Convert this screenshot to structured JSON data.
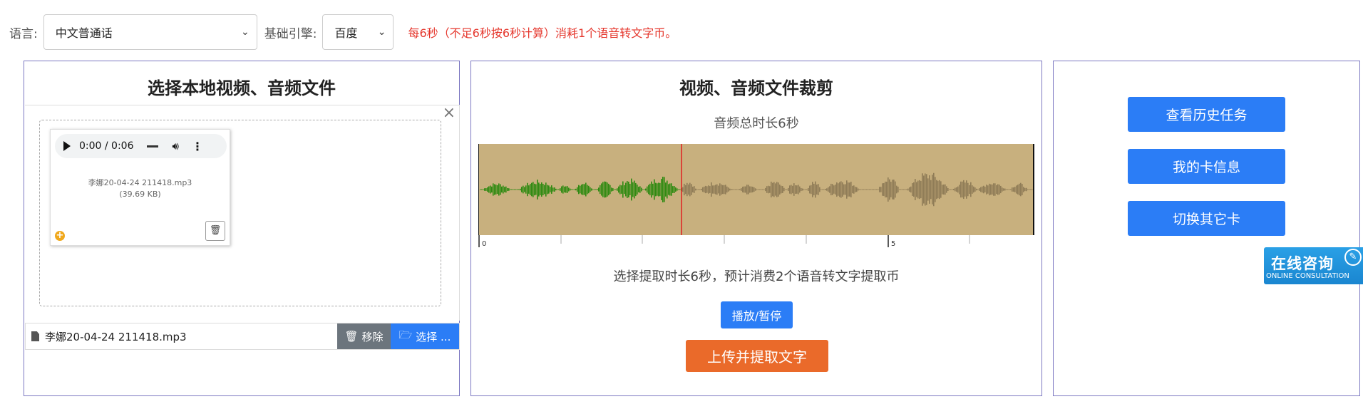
{
  "settings": {
    "language_label": "语言:",
    "language_value": "中文普通话",
    "engine_label": "基础引擎:",
    "engine_value": "百度",
    "notice": "每6秒（不足6秒按6秒计算）消耗1个语音转文字币。"
  },
  "left_panel": {
    "title": "选择本地视频、音频文件",
    "close_label": "×",
    "audio": {
      "time": "0:00 / 0:06"
    },
    "file_caption_name": "李娜20-04-24 211418.mp3",
    "file_caption_size": "(39.69 KB)",
    "file_name": "李娜20-04-24 211418.mp3",
    "remove_label": "移除",
    "choose_label": "选择 ..."
  },
  "middle_panel": {
    "title": "视频、音频文件裁剪",
    "duration_text": "音频总时长6秒",
    "timeline_labels": [
      "0",
      "5"
    ],
    "playhead_fraction": 0.365,
    "extract_text": "选择提取时长6秒，预计消费2个语音转文字提取币",
    "play_pause_label": "播放/暂停",
    "upload_label": "上传并提取文字"
  },
  "right_panel": {
    "buttons": [
      {
        "label": "查看历史任务"
      },
      {
        "label": "我的卡信息"
      },
      {
        "label": "切换其它卡"
      }
    ]
  },
  "consult_widget": {
    "title": "在线咨询",
    "subtitle": "ONLINE CONSULTATION"
  },
  "colors": {
    "accent_blue": "#2b7df6",
    "upload_orange": "#ea6a2a",
    "notice_red": "#e5352b",
    "wave_played": "#2e8a11",
    "wave_unplayed": "#8f7c57",
    "wave_background": "#c8b07e",
    "playhead": "#e02020",
    "panel_border": "#7d79c2"
  },
  "icons": [
    "play-icon",
    "volume-icon",
    "more-icon",
    "trash-icon",
    "add-icon",
    "file-icon",
    "folder-icon",
    "close-icon",
    "consult-icon"
  ]
}
